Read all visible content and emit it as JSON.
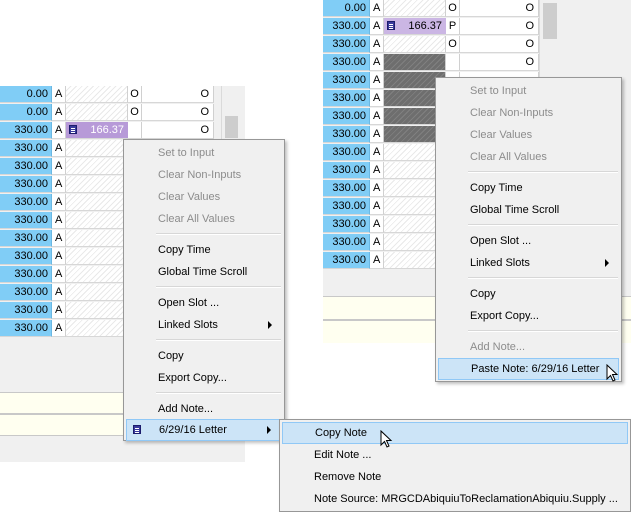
{
  "left_grid": {
    "rows": [
      {
        "value": "0.00",
        "flag": "A",
        "c3": "O",
        "c5": "O"
      },
      {
        "value": "0.00",
        "flag": "A",
        "c3": "O",
        "c5": "O"
      },
      {
        "value": "330.00",
        "flag": "A",
        "note": "166.37",
        "c5": "O"
      },
      {
        "value": "330.00",
        "flag": "A"
      },
      {
        "value": "330.00",
        "flag": "A"
      },
      {
        "value": "330.00",
        "flag": "A"
      },
      {
        "value": "330.00",
        "flag": "A"
      },
      {
        "value": "330.00",
        "flag": "A"
      },
      {
        "value": "330.00",
        "flag": "A"
      },
      {
        "value": "330.00",
        "flag": "A"
      },
      {
        "value": "330.00",
        "flag": "A"
      },
      {
        "value": "330.00",
        "flag": "A"
      },
      {
        "value": "330.00",
        "flag": "A"
      },
      {
        "value": "330.00",
        "flag": "A"
      }
    ]
  },
  "right_grid": {
    "rows": [
      {
        "value": "0.00",
        "flag": "A",
        "c4": "O",
        "c5": "O"
      },
      {
        "value": "330.00",
        "flag": "A",
        "note": "166.37",
        "c4": "P",
        "c5": "O"
      },
      {
        "value": "330.00",
        "flag": "A",
        "c4": "O",
        "c5": "O"
      },
      {
        "value": "330.00",
        "flag": "A",
        "dark": true,
        "c5": "O"
      },
      {
        "value": "330.00",
        "flag": "A",
        "dark": true
      },
      {
        "value": "330.00",
        "flag": "A",
        "dark": true
      },
      {
        "value": "330.00",
        "flag": "A",
        "dark": true
      },
      {
        "value": "330.00",
        "flag": "A",
        "dark": true
      },
      {
        "value": "330.00",
        "flag": "A"
      },
      {
        "value": "330.00",
        "flag": "A"
      },
      {
        "value": "330.00",
        "flag": "A"
      },
      {
        "value": "330.00",
        "flag": "A"
      },
      {
        "value": "330.00",
        "flag": "A"
      },
      {
        "value": "330.00",
        "flag": "A"
      },
      {
        "value": "330.00",
        "flag": "A"
      }
    ]
  },
  "menu_left": {
    "items": [
      {
        "label": "Set to Input",
        "disabled": true
      },
      {
        "label": "Clear Non-Inputs",
        "disabled": true
      },
      {
        "label": "Clear Values",
        "disabled": true
      },
      {
        "label": "Clear All Values",
        "disabled": true
      },
      {
        "label": "Copy Time"
      },
      {
        "label": "Global Time Scroll"
      },
      {
        "label": "Open Slot ..."
      },
      {
        "label": "Linked Slots"
      },
      {
        "label": "Copy"
      },
      {
        "label": "Export Copy..."
      },
      {
        "label": "Add Note..."
      },
      {
        "label": "6/29/16 Letter"
      }
    ]
  },
  "submenu": {
    "items": [
      {
        "label": "Copy Note"
      },
      {
        "label": "Edit Note ..."
      },
      {
        "label": "Remove Note"
      },
      {
        "label": "Note Source: MRGCDAbiquiuToReclamationAbiquiu.Supply ..."
      }
    ]
  },
  "menu_right": {
    "items": [
      {
        "label": "Set to Input",
        "disabled": true
      },
      {
        "label": "Clear Non-Inputs",
        "disabled": true
      },
      {
        "label": "Clear Values",
        "disabled": true
      },
      {
        "label": "Clear All Values",
        "disabled": true
      },
      {
        "label": "Copy Time"
      },
      {
        "label": "Global Time Scroll"
      },
      {
        "label": "Open Slot ..."
      },
      {
        "label": "Linked Slots"
      },
      {
        "label": "Copy"
      },
      {
        "label": "Export Copy..."
      },
      {
        "label": "Add Note...",
        "disabled": true
      },
      {
        "label": "Paste Note: 6/29/16 Letter"
      }
    ]
  },
  "icons": {
    "submenu_arrow": "chevron-right-icon",
    "note": "note-icon",
    "cursor": "mouse-cursor-icon"
  },
  "colors": {
    "value_column": "#80cdf6",
    "note_cell": "#b79ad8",
    "highlight": "#cce4f7",
    "menu_bg": "#f0f0f0"
  }
}
